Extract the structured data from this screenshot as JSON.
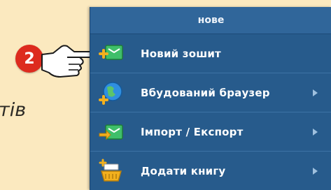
{
  "background_text": "тів",
  "step_badge": "2",
  "menu": {
    "title": "нове",
    "items": [
      {
        "label": "Новий зошит",
        "icon": "new-notebook-icon",
        "has_submenu": false
      },
      {
        "label": "Вбудований браузер",
        "icon": "globe-add-icon",
        "has_submenu": true
      },
      {
        "label": "Імпорт / Експорт",
        "icon": "import-export-icon",
        "has_submenu": true
      },
      {
        "label": "Додати книгу",
        "icon": "add-book-basket-icon",
        "has_submenu": true
      }
    ]
  },
  "colors": {
    "page_background": "#fbe9bf",
    "menu_background": "#275b8c",
    "menu_header": "#30669a",
    "badge": "#dd2b1e"
  }
}
